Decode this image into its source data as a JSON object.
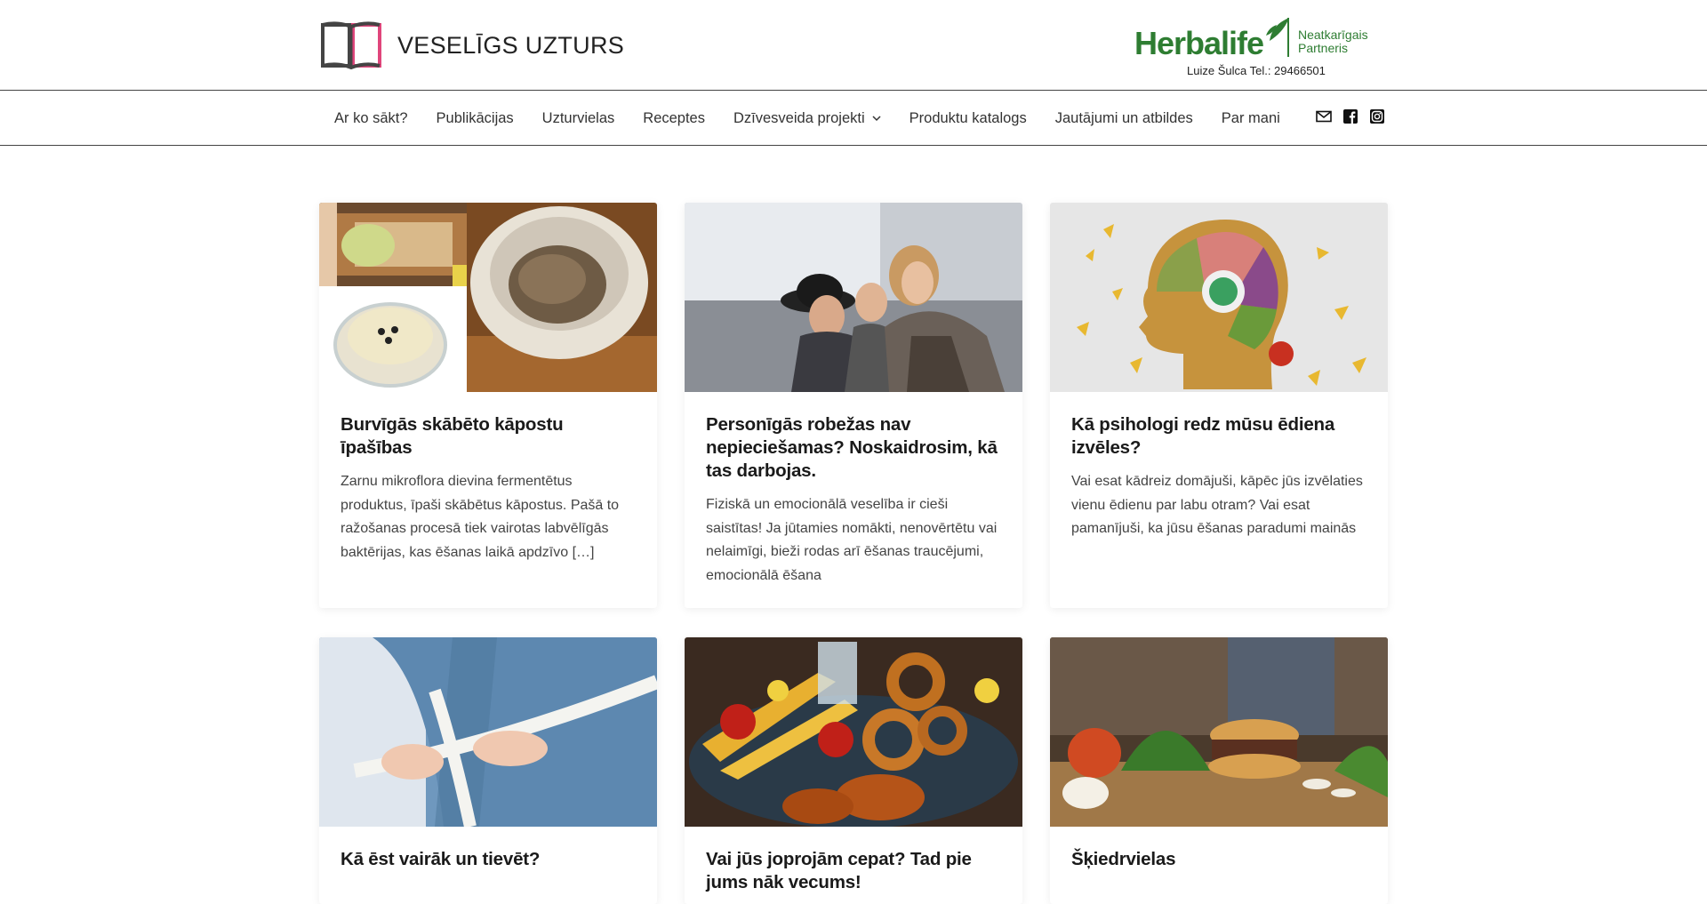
{
  "site": {
    "title": "VESELĪGS UZTURS"
  },
  "partner": {
    "brand": "Herbalife",
    "badge_line1": "Neatkarīgais",
    "badge_line2": "Partneris",
    "contact": "Luize Šulca Tel.: 29466501"
  },
  "nav": {
    "items": [
      {
        "label": "Ar ko sākt?"
      },
      {
        "label": "Publikācijas"
      },
      {
        "label": "Uzturvielas"
      },
      {
        "label": "Receptes"
      },
      {
        "label": "Dzīvesveida projekti"
      },
      {
        "label": "Produktu katalogs"
      },
      {
        "label": "Jautājumi un atbildes"
      },
      {
        "label": "Par mani"
      }
    ],
    "social": [
      "email-icon",
      "facebook-icon",
      "instagram-icon"
    ]
  },
  "cards": [
    {
      "title": "Burvīgās skābēto kāpostu īpašības",
      "excerpt": "Zarnu mikroflora dievina fermentētus produktus, īpaši skābētus kāpostus. Pašā to ražošanas procesā tiek vairotas labvēlīgās baktērijas, kas ēšanas laikā apdzīvo […]"
    },
    {
      "title": "Personīgās robežas nav nepieciešamas? Noskaidrosim, kā tas darbojas.",
      "excerpt": "Fiziskā un emocionālā veselība ir cieši saistītas! Ja jūtamies nomākti, nenovērtētu vai nelaimīgi, bieži rodas arī ēšanas traucējumi, emocionālā ēšana"
    },
    {
      "title": "Kā psihologi redz mūsu ēdiena izvēles?",
      "excerpt": "Vai esat kādreiz domājuši, kāpēc jūs izvēlaties vienu ēdienu par labu otram? Vai esat pamanījuši, ka jūsu ēšanas paradumi mainās"
    },
    {
      "title": "Kā ēst vairāk un tievēt?",
      "excerpt": ""
    },
    {
      "title": "Vai jūs joprojām cepat? Tad pie jums nāk vecums!",
      "excerpt": ""
    },
    {
      "title": "Šķiedrvielas",
      "excerpt": ""
    }
  ]
}
